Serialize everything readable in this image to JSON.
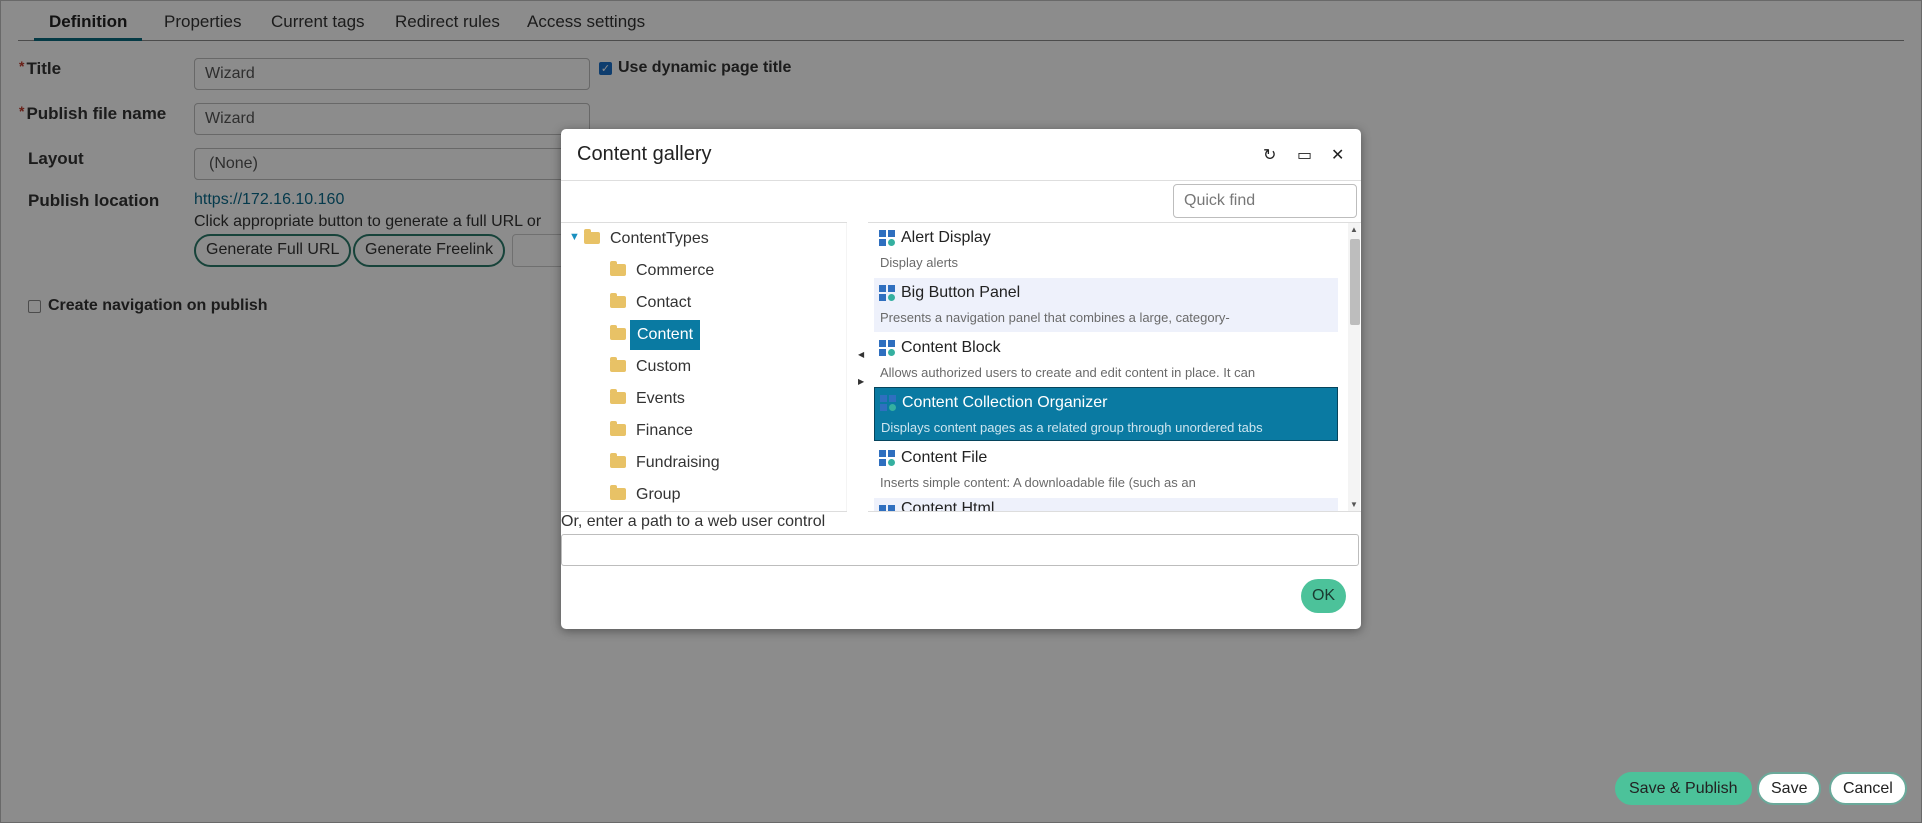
{
  "tabs": [
    "Definition",
    "Properties",
    "Current tags",
    "Redirect rules",
    "Access settings"
  ],
  "form": {
    "title_label": "Title",
    "title_value": "Wizard",
    "use_dynamic_label": "Use dynamic page title",
    "publish_file_label": "Publish file name",
    "publish_file_value": "Wizard",
    "layout_label": "Layout",
    "layout_value": "(None)",
    "publish_location_label": "Publish location",
    "publish_location_url": "https://172.16.10.160",
    "publish_hint": "Click appropriate button to generate a full URL or",
    "gen_full_url": "Generate Full URL",
    "gen_freelink": "Generate Freelink",
    "create_nav_label": "Create navigation on publish",
    "required_mark": "*"
  },
  "footer": {
    "save_publish": "Save & Publish",
    "save": "Save",
    "cancel": "Cancel"
  },
  "modal": {
    "title": "Content gallery",
    "refresh_icon": "↻",
    "maximize_icon": "▭",
    "close_icon": "✕",
    "quick_find_placeholder": "Quick find",
    "tree": {
      "root": "ContentTypes",
      "children": [
        "Commerce",
        "Contact",
        "Content",
        "Custom",
        "Events",
        "Finance",
        "Fundraising",
        "Group"
      ],
      "selected": "Content"
    },
    "items": [
      {
        "title": "Alert Display",
        "desc": "Display alerts"
      },
      {
        "title": "Big Button Panel",
        "desc": "Presents a navigation panel that combines a large, category-"
      },
      {
        "title": "Content Block",
        "desc": "Allows authorized users to create and edit content in place. It can"
      },
      {
        "title": "Content Collection Organizer",
        "desc": "Displays content pages as a related group through unordered tabs"
      },
      {
        "title": "Content File",
        "desc": "Inserts simple content: A downloadable file (such as an"
      },
      {
        "title": "Content Html",
        "desc": ""
      }
    ],
    "path_label": "Or, enter a path to a web user control",
    "path_value": "",
    "ok_label": "OK"
  }
}
